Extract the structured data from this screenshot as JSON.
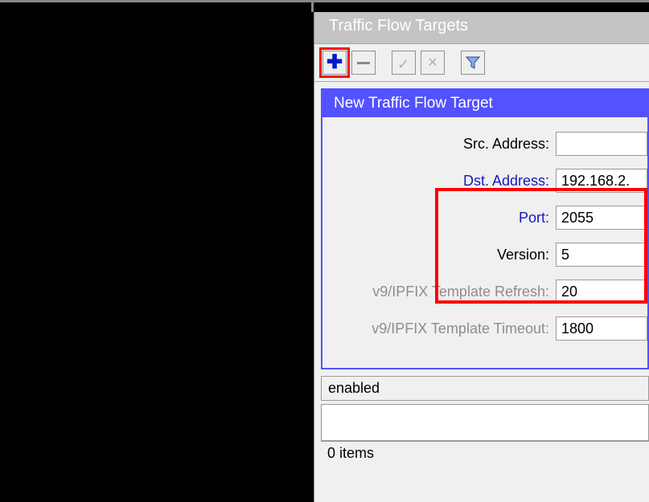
{
  "window": {
    "title": "Traffic Flow Targets"
  },
  "toolbar": {
    "add": "+",
    "remove": "−"
  },
  "editor": {
    "title": "New Traffic Flow Target",
    "labels": {
      "src_address": "Src. Address:",
      "dst_address": "Dst. Address:",
      "port": "Port:",
      "version": "Version:",
      "template_refresh": "v9/IPFIX Template Refresh:",
      "template_timeout": "v9/IPFIX Template Timeout:"
    },
    "values": {
      "src_address": "",
      "dst_address": "192.168.2.",
      "port": "2055",
      "version": "5",
      "template_refresh": "20",
      "template_timeout": "1800"
    }
  },
  "status": "enabled",
  "footer": "0 items"
}
